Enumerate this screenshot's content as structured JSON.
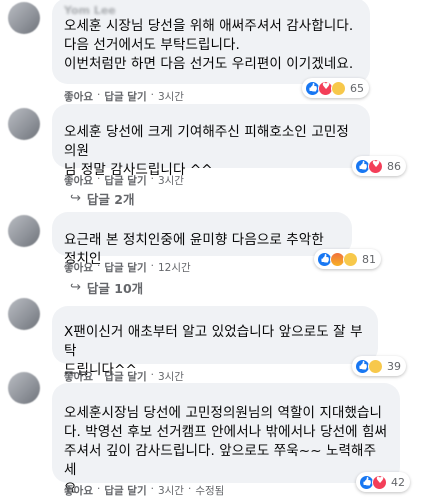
{
  "comments": [
    {
      "author": "Yom Lee",
      "text": "오세훈 시장님 당선을 위해 애써주셔서 감사합니다.\n다음 선거에서도 부탁드립니다.\n이번처럼만 하면 다음 선거도 우리편이 이기겠네요.",
      "reaction_count": "65",
      "like": "좋아요",
      "reply": "답글 달기",
      "time": "3시간",
      "edited": ""
    },
    {
      "author": "",
      "text": "오세훈 당선에 크게 기여해주신 피해호소인 고민정 의원\n님 정말 감사드립니다 ^^",
      "reaction_count": "86",
      "like": "좋아요",
      "reply": "답글 달기",
      "time": "3시간",
      "replies": "답글 2개"
    },
    {
      "author": "",
      "text": "요근래 본 정치인중에 윤미향 다음으로 추악한 정치인",
      "reaction_count": "81",
      "like": "좋아요",
      "reply": "답글 달기",
      "time": "12시간",
      "replies": "답글 10개"
    },
    {
      "author": "",
      "text": "X팬이신거 애초부터 알고 있었습니다 앞으로도 잘 부탁\n드립니다^^",
      "reaction_count": "39",
      "like": "좋아요",
      "reply": "답글 달기",
      "time": "3시간"
    },
    {
      "author": "",
      "text": "오세훈시장님 당선에 고민정의원님의 역할이 지대했습니\n다. 박영선 후보 선거캠프 안에서나 밖에서나 당선에 힘써\n주셔서 깊이 감사드립니다. 앞으로도 쭈욱~~ 노력해주세\n요",
      "reaction_count": "42",
      "like": "좋아요",
      "reply": "답글 달기",
      "time": "3시간",
      "edited": "수정됨"
    }
  ],
  "separator": "·"
}
